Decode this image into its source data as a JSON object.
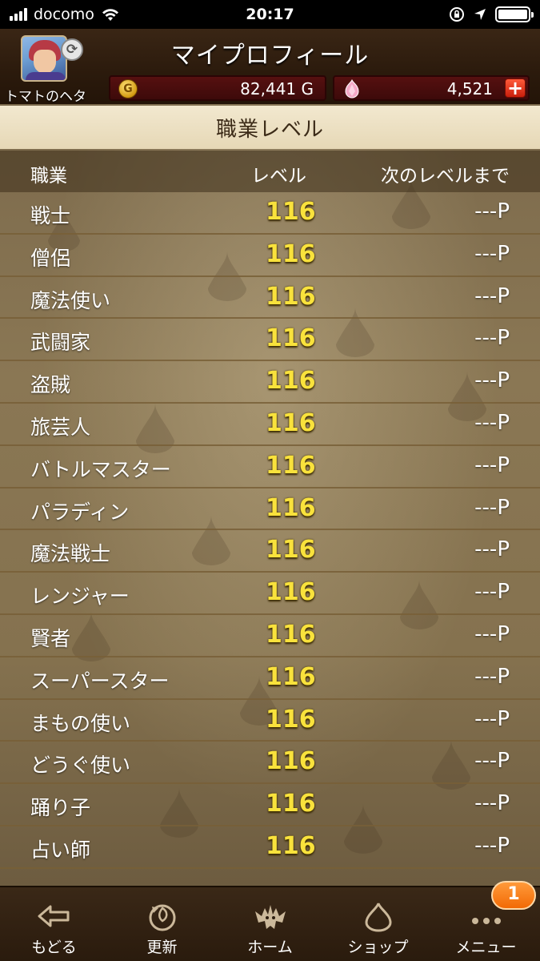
{
  "status_bar": {
    "carrier": "docomo",
    "time": "20:17"
  },
  "header": {
    "title": "マイプロフィール",
    "player_name": "トマトのヘタ",
    "gold": "82,441 G",
    "gems": "4,521",
    "gold_icon_label": "G"
  },
  "section": {
    "title": "職業レベル"
  },
  "table": {
    "columns": {
      "job": "職業",
      "level": "レベル",
      "next": "次のレベルまで"
    },
    "rows": [
      {
        "job": "戦士",
        "level": "116",
        "next": "---P"
      },
      {
        "job": "僧侶",
        "level": "116",
        "next": "---P"
      },
      {
        "job": "魔法使い",
        "level": "116",
        "next": "---P"
      },
      {
        "job": "武闘家",
        "level": "116",
        "next": "---P"
      },
      {
        "job": "盗賊",
        "level": "116",
        "next": "---P"
      },
      {
        "job": "旅芸人",
        "level": "116",
        "next": "---P"
      },
      {
        "job": "バトルマスター",
        "level": "116",
        "next": "---P"
      },
      {
        "job": "パラディン",
        "level": "116",
        "next": "---P"
      },
      {
        "job": "魔法戦士",
        "level": "116",
        "next": "---P"
      },
      {
        "job": "レンジャー",
        "level": "116",
        "next": "---P"
      },
      {
        "job": "賢者",
        "level": "116",
        "next": "---P"
      },
      {
        "job": "スーパースター",
        "level": "116",
        "next": "---P"
      },
      {
        "job": "まもの使い",
        "level": "116",
        "next": "---P"
      },
      {
        "job": "どうぐ使い",
        "level": "116",
        "next": "---P"
      },
      {
        "job": "踊り子",
        "level": "116",
        "next": "---P"
      },
      {
        "job": "占い師",
        "level": "116",
        "next": "---P"
      }
    ]
  },
  "bottom_nav": {
    "items": [
      {
        "label": "もどる",
        "icon": "back-arrow-icon"
      },
      {
        "label": "更新",
        "icon": "refresh-icon"
      },
      {
        "label": "ホーム",
        "icon": "dragon-home-icon"
      },
      {
        "label": "ショップ",
        "icon": "slime-shop-icon"
      },
      {
        "label": "メニュー",
        "icon": "menu-dots-icon"
      }
    ],
    "menu_badge": "1"
  },
  "colors": {
    "level_text": "#f9e23c",
    "header_bg": "#2b1a0c",
    "currency_bg": "#561010",
    "badge": "#f26a05"
  }
}
